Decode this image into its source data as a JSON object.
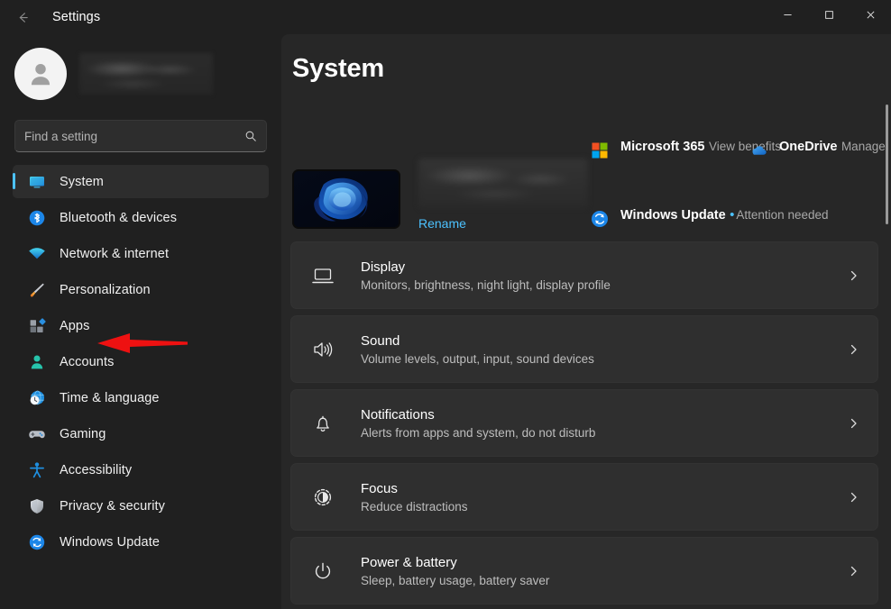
{
  "window": {
    "title": "Settings",
    "back_icon": "back-arrow-icon",
    "controls": {
      "minimize": "minimize-icon",
      "maximize": "maximize-icon",
      "close": "close-icon"
    }
  },
  "accent_color": "#4cc2ff",
  "sidebar": {
    "account": {
      "avatar_icon": "user-avatar-icon",
      "name_redacted": ""
    },
    "search": {
      "placeholder": "Find a setting",
      "value": "",
      "icon": "search-icon"
    },
    "items": [
      {
        "label": "System",
        "icon": "system-monitor-icon",
        "selected": true
      },
      {
        "label": "Bluetooth & devices",
        "icon": "bluetooth-icon",
        "selected": false
      },
      {
        "label": "Network & internet",
        "icon": "wifi-icon",
        "selected": false
      },
      {
        "label": "Personalization",
        "icon": "paintbrush-icon",
        "selected": false
      },
      {
        "label": "Apps",
        "icon": "apps-icon",
        "selected": false
      },
      {
        "label": "Accounts",
        "icon": "accounts-person-icon",
        "selected": false
      },
      {
        "label": "Time & language",
        "icon": "clock-globe-icon",
        "selected": false
      },
      {
        "label": "Gaming",
        "icon": "gamepad-icon",
        "selected": false
      },
      {
        "label": "Accessibility",
        "icon": "accessibility-icon",
        "selected": false
      },
      {
        "label": "Privacy & security",
        "icon": "shield-icon",
        "selected": false
      },
      {
        "label": "Windows Update",
        "icon": "windows-update-icon",
        "selected": false
      }
    ]
  },
  "main": {
    "page_title": "System",
    "device": {
      "thumbnail": "windows-bloom-wallpaper",
      "name_redacted": "",
      "rename_link": "Rename"
    },
    "quick_links": [
      {
        "title": "Microsoft 365",
        "subtitle": "View benefits",
        "icon": "microsoft-logo-icon",
        "has_dot": false
      },
      {
        "title": "OneDrive",
        "subtitle": "Manage",
        "icon": "onedrive-cloud-icon",
        "has_dot": false
      },
      {
        "title": "Windows Update",
        "subtitle": "Attention needed",
        "icon": "windows-update-icon",
        "has_dot": true
      }
    ],
    "cards": [
      {
        "title": "Display",
        "subtitle": "Monitors, brightness, night light, display profile",
        "icon": "monitor-icon",
        "chevron": "chevron-right-icon"
      },
      {
        "title": "Sound",
        "subtitle": "Volume levels, output, input, sound devices",
        "icon": "speaker-icon",
        "chevron": "chevron-right-icon"
      },
      {
        "title": "Notifications",
        "subtitle": "Alerts from apps and system, do not disturb",
        "icon": "bell-icon",
        "chevron": "chevron-right-icon"
      },
      {
        "title": "Focus",
        "subtitle": "Reduce distractions",
        "icon": "focus-icon",
        "chevron": "chevron-right-icon"
      },
      {
        "title": "Power & battery",
        "subtitle": "Sleep, battery usage, battery saver",
        "icon": "power-icon",
        "chevron": "chevron-right-icon"
      }
    ]
  },
  "annotation": {
    "arrow_color": "#ee1111",
    "points_at": "Apps"
  }
}
